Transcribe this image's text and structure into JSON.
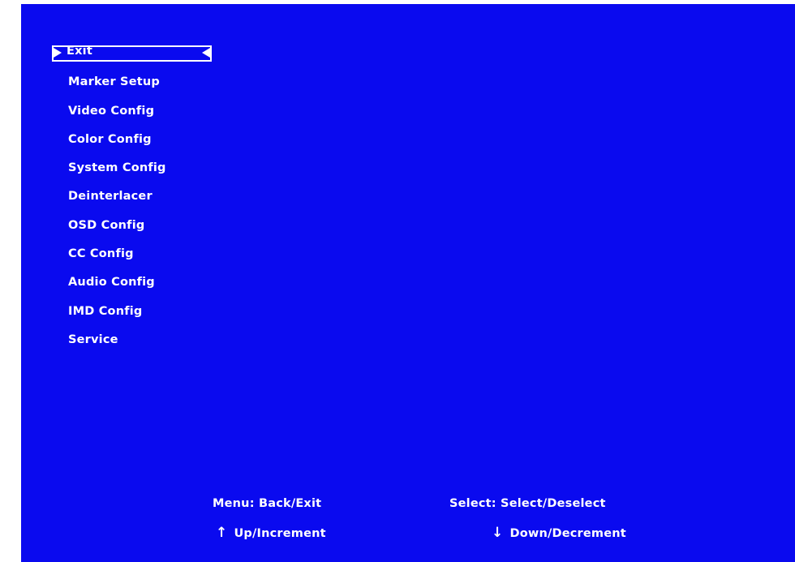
{
  "menu": {
    "items": [
      {
        "label": "Exit",
        "selected": true
      },
      {
        "label": "Marker Setup"
      },
      {
        "label": "Video Config"
      },
      {
        "label": "Color Config"
      },
      {
        "label": "System Config"
      },
      {
        "label": "Deinterlacer"
      },
      {
        "label": "OSD Config"
      },
      {
        "label": "CC Config"
      },
      {
        "label": "Audio Config"
      },
      {
        "label": "IMD Config"
      },
      {
        "label": "Service"
      }
    ],
    "selection_arrows": {
      "left_icon": "triangle-right",
      "right_icon": "triangle-left"
    }
  },
  "footer": {
    "menu_hint": "Menu: Back/Exit",
    "select_hint": "Select: Select/Deselect",
    "up_hint": "Up/Increment",
    "up_icon": "↑",
    "down_hint": "Down/Decrement",
    "down_icon": "↓"
  },
  "colors": {
    "background": "#0a0aef",
    "text": "#ffffff"
  }
}
